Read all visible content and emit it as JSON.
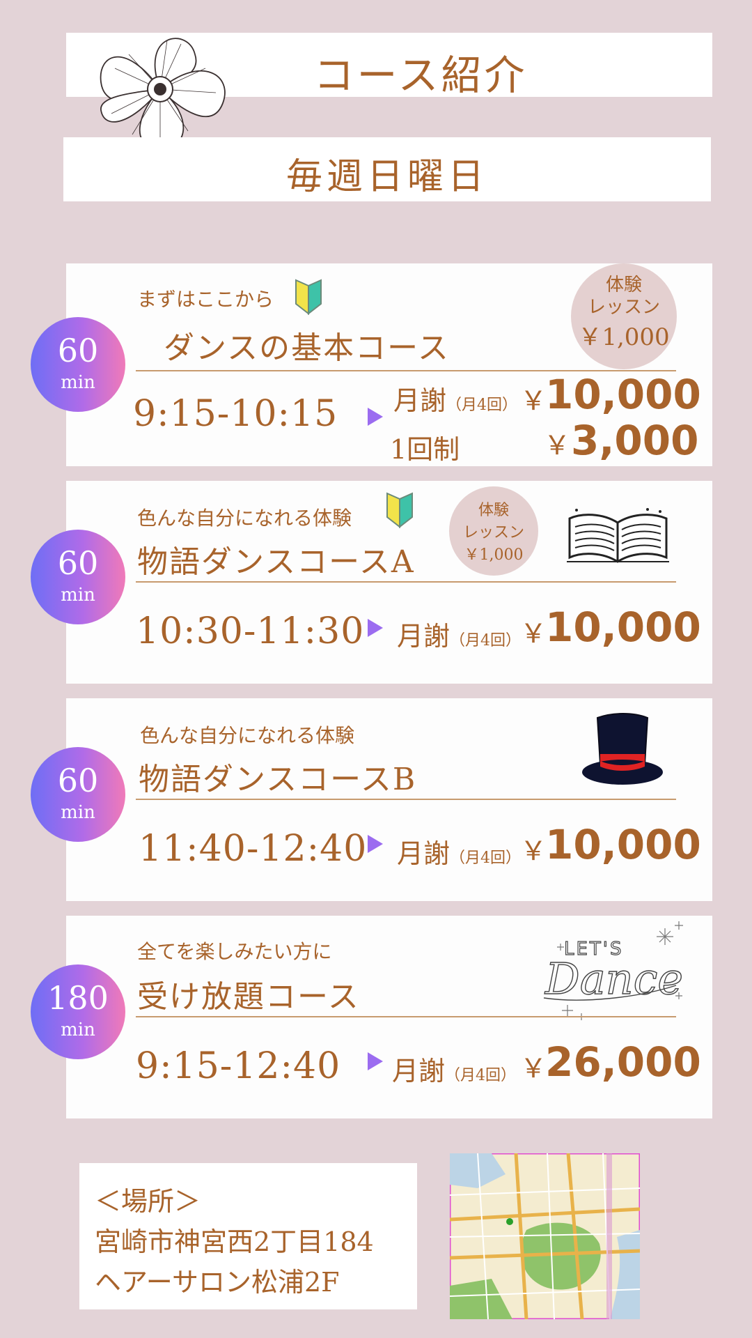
{
  "header": {
    "title": "コース紹介",
    "day": "毎週日曜日"
  },
  "courses": [
    {
      "duration": "60",
      "unit": "min",
      "subtitle": "まずはここから",
      "name": "ダンスの基本コース",
      "time": "9:15-10:15",
      "fee_label": "月謝",
      "fee_note": "（月4回）",
      "yen": "￥",
      "price": "10,000",
      "fee2_label": "1回制",
      "price2": "3,000",
      "trial": {
        "line1": "体験",
        "line2": "レッスン",
        "price": "￥1,000"
      }
    },
    {
      "duration": "60",
      "unit": "min",
      "subtitle": "色んな自分になれる体験",
      "name": "物語ダンスコースA",
      "time": "10:30-11:30",
      "fee_label": "月謝",
      "fee_note": "（月4回）",
      "yen": "￥",
      "price": "10,000",
      "trial": {
        "line1": "体験",
        "line2": "レッスン",
        "price": "￥1,000"
      }
    },
    {
      "duration": "60",
      "unit": "min",
      "subtitle": "色んな自分になれる体験",
      "name": "物語ダンスコースB",
      "time": "11:40-12:40",
      "fee_label": "月謝",
      "fee_note": "（月4回）",
      "yen": "￥",
      "price": "10,000"
    },
    {
      "duration": "180",
      "unit": "min",
      "subtitle": "全てを楽しみたい方に",
      "name": "受け放題コース",
      "time": "9:15-12:40",
      "fee_label": "月謝",
      "fee_note": "（月4回）",
      "yen": "￥",
      "price": "26,000"
    }
  ],
  "location": {
    "heading": "＜場所＞",
    "address": "宮崎市神宮西2丁目184",
    "building": "ヘアーサロン松浦2F"
  },
  "decorations": {
    "lets_dance": "LET'S Dance",
    "icons": [
      "flower-icon",
      "beginner-mark-icon",
      "open-book-icon",
      "top-hat-icon",
      "lets-dance-logo",
      "map-image"
    ]
  },
  "colors": {
    "background": "#e3d3d7",
    "text": "#a8632b",
    "trial_badge": "#e4d0d0",
    "rule": "#c79a6e"
  }
}
